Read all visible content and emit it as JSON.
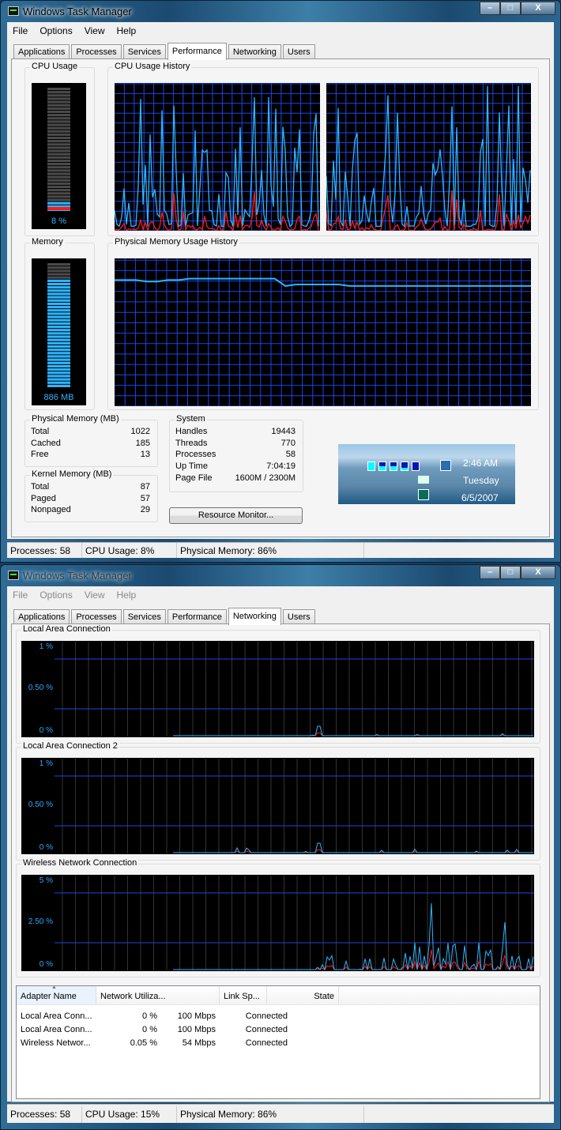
{
  "window1": {
    "title": "Windows Task Manager",
    "caption_buttons": {
      "minimize": "–",
      "maximize": "□",
      "close": "X"
    },
    "menu": [
      "File",
      "Options",
      "View",
      "Help"
    ],
    "tabs": [
      "Applications",
      "Processes",
      "Services",
      "Performance",
      "Networking",
      "Users"
    ],
    "selected_tab": "Performance",
    "cpu_usage": {
      "label": "CPU Usage",
      "value_text": "8 %",
      "percent": 8
    },
    "cpu_history": {
      "label": "CPU Usage History",
      "cores": 2
    },
    "memory": {
      "label": "Memory",
      "value_text": "886 MB",
      "percent": 86
    },
    "memory_history": {
      "label": "Physical Memory Usage History",
      "levels_percent": [
        88,
        88,
        88,
        87,
        87,
        88,
        88,
        89,
        89,
        89,
        89,
        89,
        89,
        89,
        89,
        89,
        84,
        85,
        85,
        85,
        85,
        85,
        84,
        84,
        84,
        84,
        84,
        84,
        84,
        84,
        84,
        84,
        84,
        84,
        84,
        84,
        84,
        84,
        84,
        84
      ]
    },
    "physical_memory": {
      "label": "Physical Memory (MB)",
      "rows": [
        {
          "k": "Total",
          "v": "1022"
        },
        {
          "k": "Cached",
          "v": "185"
        },
        {
          "k": "Free",
          "v": "13"
        }
      ]
    },
    "kernel_memory": {
      "label": "Kernel Memory (MB)",
      "rows": [
        {
          "k": "Total",
          "v": "87"
        },
        {
          "k": "Paged",
          "v": "57"
        },
        {
          "k": "Nonpaged",
          "v": "29"
        }
      ]
    },
    "system": {
      "label": "System",
      "rows": [
        {
          "k": "Handles",
          "v": "19443"
        },
        {
          "k": "Threads",
          "v": "770"
        },
        {
          "k": "Processes",
          "v": "58"
        },
        {
          "k": "Up Time",
          "v": "7:04:19"
        },
        {
          "k": "Page File",
          "v": "1600M / 2300M"
        }
      ]
    },
    "resource_monitor_button": "Resource Monitor...",
    "gadget": {
      "time": "2:46 AM",
      "day": "Tuesday",
      "date": "6/5/2007"
    },
    "status": {
      "processes": "Processes: 58",
      "cpu": "CPU Usage: 8%",
      "memory": "Physical Memory: 86%"
    }
  },
  "window2": {
    "title": "Windows Task Manager",
    "menu": [
      "File",
      "Options",
      "View",
      "Help"
    ],
    "tabs": [
      "Applications",
      "Processes",
      "Services",
      "Performance",
      "Networking",
      "Users"
    ],
    "selected_tab": "Networking",
    "graphs": [
      {
        "label": "Local Area Connection",
        "axis": [
          "1 %",
          "0.50 %",
          "0 %"
        ]
      },
      {
        "label": "Local Area Connection 2",
        "axis": [
          "1 %",
          "0.50 %",
          "0 %"
        ]
      },
      {
        "label": "Wireless Network Connection",
        "axis": [
          "5 %",
          "2.50 %",
          "0 %"
        ]
      }
    ],
    "list": {
      "columns": [
        "Adapter Name",
        "Network Utiliza...",
        "Link Sp...",
        "State"
      ],
      "rows": [
        [
          "Local Area Conn...",
          "0 %",
          "100 Mbps",
          "Connected"
        ],
        [
          "Local Area Conn...",
          "0 %",
          "100 Mbps",
          "Connected"
        ],
        [
          "Wireless Networ...",
          "0.05 %",
          "54 Mbps",
          "Connected"
        ]
      ]
    },
    "status": {
      "processes": "Processes: 58",
      "cpu": "CPU Usage: 15%",
      "memory": "Physical Memory: 86%"
    }
  },
  "colors": {
    "grid": "#1a46e6",
    "cpu_line": "#2fb4ff",
    "kernel_line": "#ff1a1a",
    "meter": "#2fb4ff"
  }
}
